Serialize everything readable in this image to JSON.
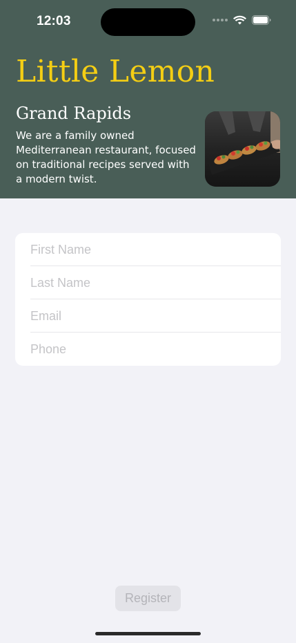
{
  "status_bar": {
    "time": "12:03",
    "icons": [
      "cellular-signal-icon",
      "wifi-icon",
      "battery-icon"
    ]
  },
  "header": {
    "title": "Little Lemon",
    "city": "Grand Rapids",
    "description": "We are a family owned Mediterranean restaurant, focused on traditional recipes served with a modern twist."
  },
  "form": {
    "first_name": {
      "placeholder": "First Name",
      "value": ""
    },
    "last_name": {
      "placeholder": "Last Name",
      "value": ""
    },
    "email": {
      "placeholder": "Email",
      "value": ""
    },
    "phone": {
      "placeholder": "Phone",
      "value": ""
    }
  },
  "register": {
    "label": "Register",
    "enabled": false
  },
  "colors": {
    "brand_green": "#495e57",
    "brand_yellow": "#f4ce14",
    "background": "#f2f2f7",
    "placeholder": "#c4c4c7",
    "disabled_button_bg": "#e3e3e8",
    "disabled_button_text": "#b4b4b9"
  }
}
